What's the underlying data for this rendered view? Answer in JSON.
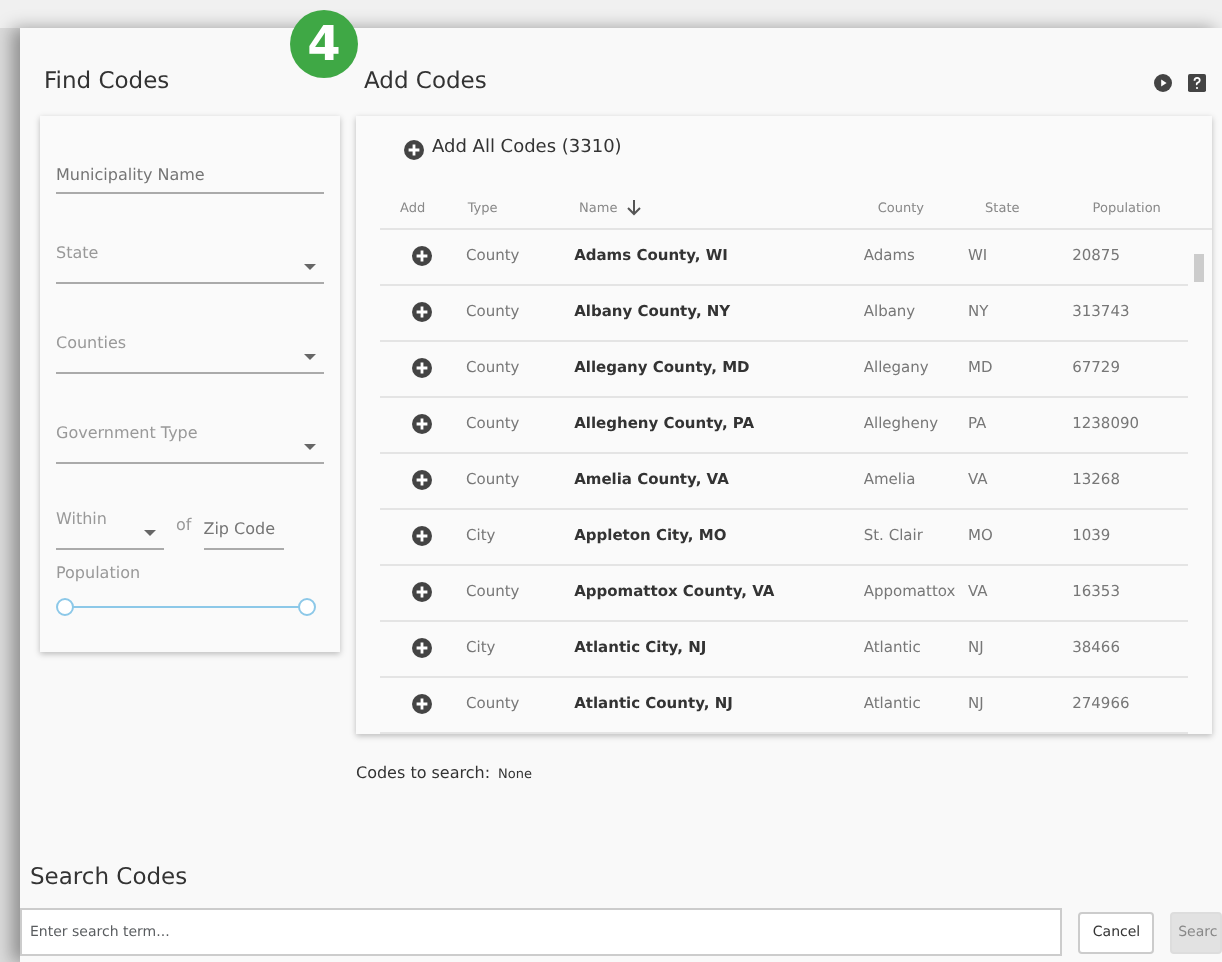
{
  "step_badge": "4",
  "find_codes": {
    "title": "Find Codes",
    "fields": [
      {
        "kind": "text",
        "placeholder": "Municipality Name"
      },
      {
        "kind": "select",
        "placeholder": "State"
      },
      {
        "kind": "select",
        "placeholder": "Counties"
      },
      {
        "kind": "select",
        "placeholder": "Government Type"
      }
    ],
    "within": {
      "placeholder": "Within",
      "joiner": "of",
      "zip_placeholder": "Zip Code"
    },
    "population": {
      "label": "Population",
      "thumbs": [
        {
          "level": 0
        },
        {
          "level": 1
        }
      ]
    }
  },
  "add_codes": {
    "title": "Add Codes",
    "add_all": "Add All Codes (3310)",
    "columns": [
      "Add",
      "Type",
      "Name",
      "County",
      "State",
      "Population"
    ],
    "rows": [
      {
        "type": "County",
        "name": "Adams County, WI",
        "county": "Adams",
        "state": "WI",
        "population": "20875"
      },
      {
        "type": "County",
        "name": "Albany County, NY",
        "county": "Albany",
        "state": "NY",
        "population": "313743"
      },
      {
        "type": "County",
        "name": "Allegany County, MD",
        "county": "Allegany",
        "state": "MD",
        "population": "67729"
      },
      {
        "type": "County",
        "name": "Allegheny County, PA",
        "county": "Allegheny",
        "state": "PA",
        "population": "1238090"
      },
      {
        "type": "County",
        "name": "Amelia County, VA",
        "county": "Amelia",
        "state": "VA",
        "population": "13268"
      },
      {
        "type": "City",
        "name": "Appleton City, MO",
        "county": "St. Clair",
        "state": "MO",
        "population": "1039"
      },
      {
        "type": "County",
        "name": "Appomattox County, VA",
        "county": "Appomattox",
        "state": "VA",
        "population": "16353"
      },
      {
        "type": "City",
        "name": "Atlantic City, NJ",
        "county": "Atlantic",
        "state": "NJ",
        "population": "38466"
      },
      {
        "type": "County",
        "name": "Atlantic County, NJ",
        "county": "Atlantic",
        "state": "NJ",
        "population": "274966"
      }
    ],
    "codes_to_search": {
      "label": "Codes to search:",
      "value": "None"
    }
  },
  "search_codes": {
    "title": "Search Codes",
    "placeholder": "Enter search term...",
    "buttons": [
      {
        "label": "Cancel",
        "disabled": false
      },
      {
        "label": "Searc",
        "disabled": true
      }
    ]
  }
}
